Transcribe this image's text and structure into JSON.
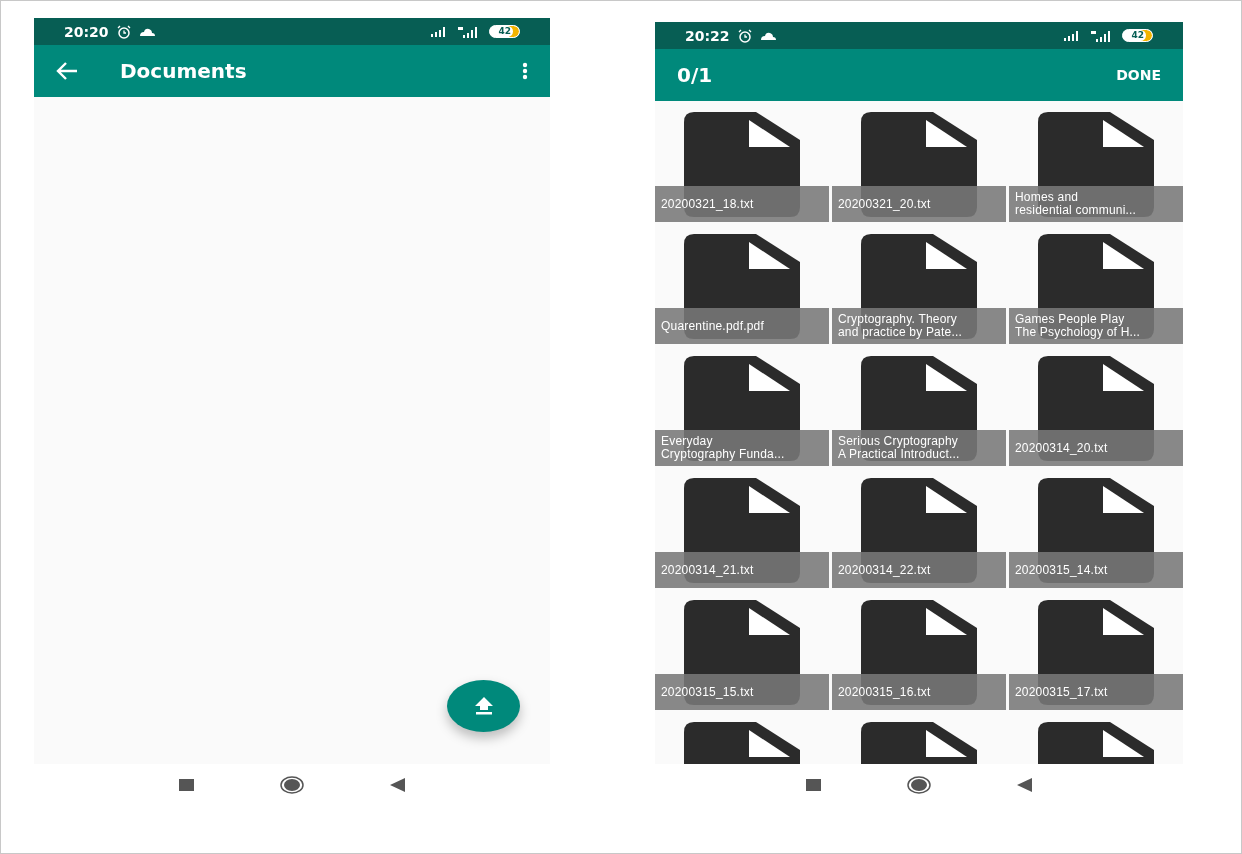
{
  "screens": [
    {
      "status_bar": {
        "time": "20:20",
        "battery": "42"
      },
      "app_bar": {
        "kind": "title",
        "title": "Documents"
      },
      "fab": {
        "kind": "upload"
      }
    },
    {
      "status_bar": {
        "time": "20:22",
        "battery": "42"
      },
      "app_bar": {
        "kind": "selection",
        "counter": "0/1",
        "action": "DONE"
      },
      "files": [
        {
          "kind": "file",
          "lines": [
            "20200321_18.txt"
          ]
        },
        {
          "kind": "file",
          "lines": [
            "20200321_20.txt"
          ]
        },
        {
          "kind": "file",
          "lines": [
            "Homes and",
            "residential communi..."
          ]
        },
        {
          "kind": "file",
          "lines": [
            "Quarentine.pdf.pdf"
          ]
        },
        {
          "kind": "file",
          "lines": [
            "Cryptography. Theory",
            "and practice by Pate..."
          ]
        },
        {
          "kind": "file",
          "lines": [
            "Games People Play",
            "The Psychology of H..."
          ]
        },
        {
          "kind": "file",
          "lines": [
            "Everyday",
            "Cryptography Funda..."
          ]
        },
        {
          "kind": "file",
          "lines": [
            "Serious Cryptography",
            "A Practical Introduct..."
          ]
        },
        {
          "kind": "file",
          "lines": [
            "20200314_20.txt"
          ]
        },
        {
          "kind": "file",
          "lines": [
            "20200314_21.txt"
          ]
        },
        {
          "kind": "file",
          "lines": [
            "20200314_22.txt"
          ]
        },
        {
          "kind": "file",
          "lines": [
            "20200315_14.txt"
          ]
        },
        {
          "kind": "file",
          "lines": [
            "20200315_15.txt"
          ]
        },
        {
          "kind": "file",
          "lines": [
            "20200315_16.txt"
          ]
        },
        {
          "kind": "file",
          "lines": [
            "20200315_17.txt"
          ]
        },
        {
          "kind": "cut"
        },
        {
          "kind": "cut"
        },
        {
          "kind": "cut"
        }
      ]
    }
  ]
}
